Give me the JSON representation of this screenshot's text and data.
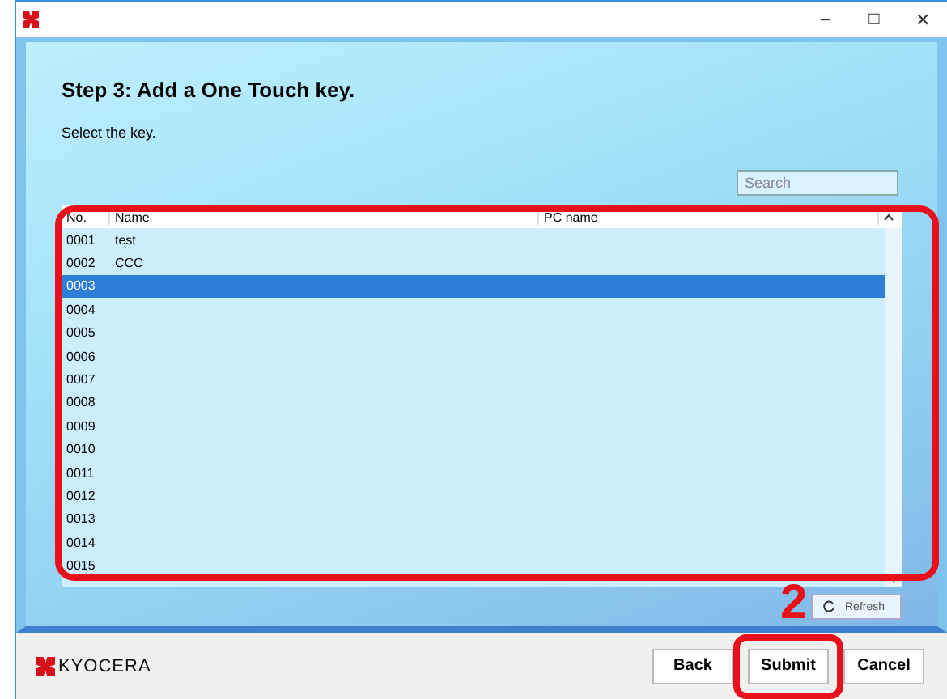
{
  "window": {
    "controls": [
      "–",
      "□",
      "✕"
    ]
  },
  "heading": "Step 3: Add a One Touch key.",
  "instruction": "Select the key.",
  "search": {
    "placeholder": "Search"
  },
  "table": {
    "columns": [
      "No.",
      "Name",
      "PC name"
    ],
    "rows": [
      {
        "no": "0001",
        "name": "test",
        "selected": false
      },
      {
        "no": "0002",
        "name": "CCC",
        "selected": false
      },
      {
        "no": "0003",
        "name": "",
        "selected": true
      },
      {
        "no": "0004",
        "name": "",
        "selected": false
      },
      {
        "no": "0005",
        "name": "",
        "selected": false
      },
      {
        "no": "0006",
        "name": "",
        "selected": false
      },
      {
        "no": "0007",
        "name": "",
        "selected": false
      },
      {
        "no": "0008",
        "name": "",
        "selected": false
      },
      {
        "no": "0009",
        "name": "",
        "selected": false
      },
      {
        "no": "0010",
        "name": "",
        "selected": false
      },
      {
        "no": "0011",
        "name": "",
        "selected": false
      },
      {
        "no": "0012",
        "name": "",
        "selected": false
      },
      {
        "no": "0013",
        "name": "",
        "selected": false
      },
      {
        "no": "0014",
        "name": "",
        "selected": false
      },
      {
        "no": "0015",
        "name": "",
        "selected": false
      }
    ]
  },
  "refresh": "Refresh",
  "callout": "2",
  "logo": "KYOCERA",
  "buttons": [
    {
      "label": "Back",
      "highlighted": false
    },
    {
      "label": "Submit",
      "highlighted": true
    },
    {
      "label": "Cancel",
      "highlighted": false
    }
  ]
}
